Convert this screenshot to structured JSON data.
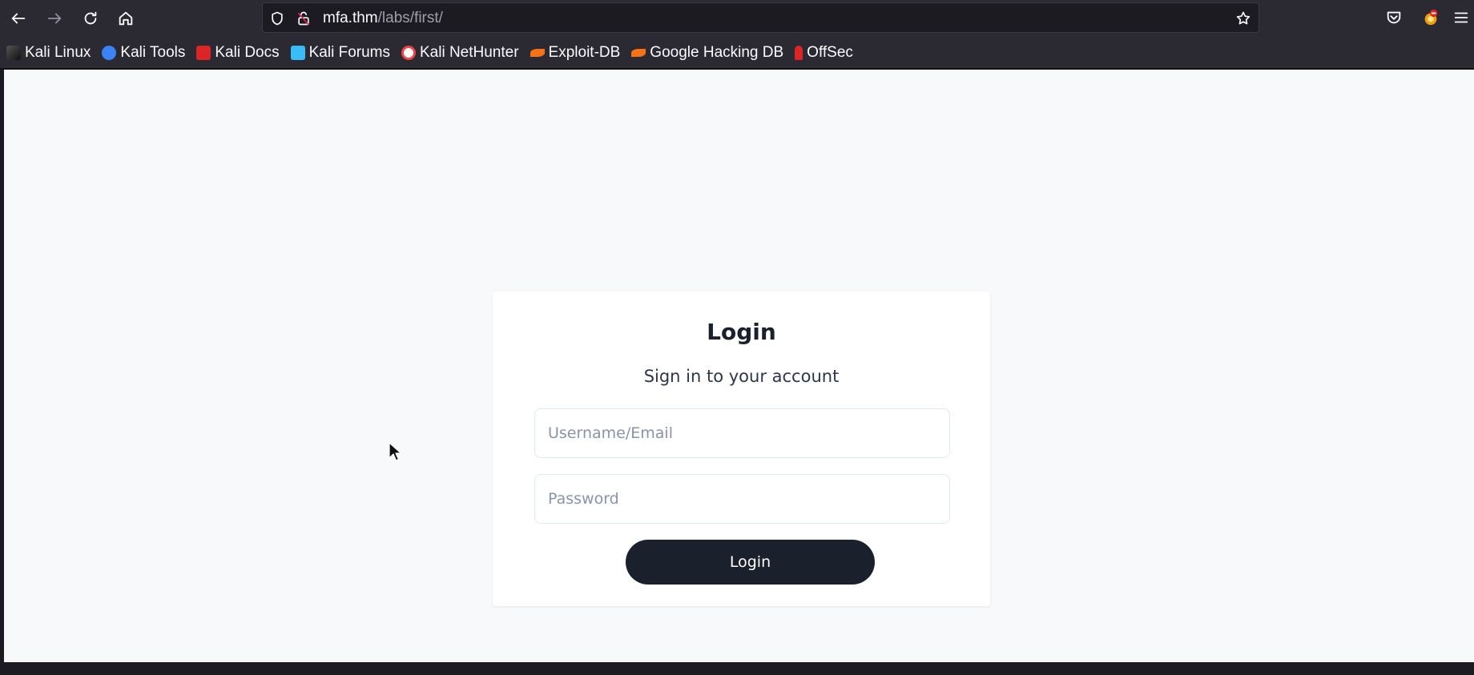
{
  "browser": {
    "url": {
      "host": "mfa.thm",
      "path": "/labs/first/"
    },
    "bookmarks": [
      {
        "label": "Kali Linux",
        "icon": "kali-linux-icon",
        "color": "#3b3b3b"
      },
      {
        "label": "Kali Tools",
        "icon": "kali-tools-icon",
        "color": "#3b82f6"
      },
      {
        "label": "Kali Docs",
        "icon": "kali-docs-icon",
        "color": "#dc2626"
      },
      {
        "label": "Kali Forums",
        "icon": "kali-forums-icon",
        "color": "#38bdf8"
      },
      {
        "label": "Kali NetHunter",
        "icon": "kali-nethunter-icon",
        "color": "#ef4444"
      },
      {
        "label": "Exploit-DB",
        "icon": "exploit-db-icon",
        "color": "#f97316"
      },
      {
        "label": "Google Hacking DB",
        "icon": "ghdb-icon",
        "color": "#f97316"
      },
      {
        "label": "OffSec",
        "icon": "offsec-icon",
        "color": "#dc2626"
      }
    ]
  },
  "login": {
    "title": "Login",
    "subtitle": "Sign in to your account",
    "username_placeholder": "Username/Email",
    "password_placeholder": "Password",
    "button_label": "Login"
  },
  "colors": {
    "chrome": "#2b2a33",
    "page_bg": "#f8f9fa",
    "button_bg": "#1a202c"
  }
}
